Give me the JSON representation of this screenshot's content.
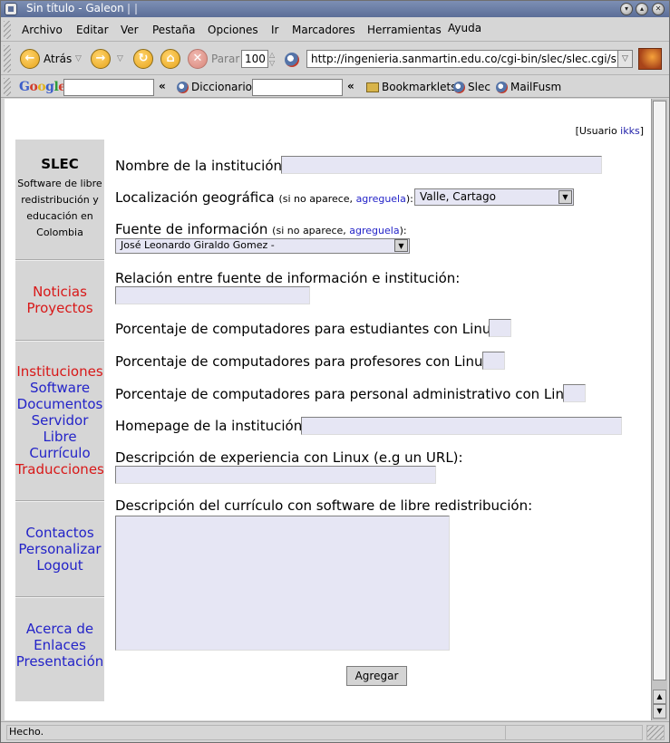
{
  "window": {
    "title": "Sin título - Galeon"
  },
  "menubar": [
    "Archivo",
    "Editar",
    "Ver",
    "Pestaña",
    "Opciones",
    "Ir",
    "Marcadores",
    "Herramientas",
    "Ayuda"
  ],
  "toolbar": {
    "back_label": "Atrás",
    "stop_label": "Parar",
    "zoom_value": "100",
    "url": "http://ingenieria.sanmartin.edu.co/cgi-bin/slec/slec.cgi/slec.a"
  },
  "bookmarks": {
    "google_label": "Google",
    "diccionario_label": "Diccionario",
    "bookmarklets_label": "Bookmarklets",
    "slec_label": "Slec",
    "mailfusm_label": "MailFusm"
  },
  "userbox": {
    "prefix": "[Usuario ",
    "user": "ikks",
    "suffix": "]"
  },
  "sidebar": {
    "title": "SLEC",
    "desc_lines": [
      "Software de libre",
      "redistribución y",
      "educación en",
      "Colombia"
    ],
    "group1": [
      {
        "label": "Noticias",
        "red": true
      },
      {
        "label": "Proyectos",
        "red": true
      }
    ],
    "group2": [
      {
        "label": "Instituciones",
        "red": true
      },
      {
        "label": "Software",
        "red": false
      },
      {
        "label": "Documentos",
        "red": false
      },
      {
        "label": "Servidor",
        "red": false
      },
      {
        "label": "Libre",
        "red": false
      },
      {
        "label": "Currículo",
        "red": false
      },
      {
        "label": "Traducciones",
        "red": true
      }
    ],
    "group3": [
      {
        "label": "Contactos",
        "red": false
      },
      {
        "label": "Personalizar",
        "red": false
      },
      {
        "label": "Logout",
        "red": false
      }
    ],
    "group4": [
      {
        "label": "Acerca de",
        "red": false
      },
      {
        "label": "Enlaces",
        "red": false
      },
      {
        "label": "Presentación",
        "red": false
      }
    ]
  },
  "form": {
    "nombre_label": "Nombre de la institución:",
    "localizacion_label": "Localización geográfica",
    "localizacion_hint_prefix": "(si no aparece, ",
    "localizacion_hint_link": "agreguela",
    "localizacion_hint_suffix": "):",
    "localizacion_value": "Valle, Cartago",
    "fuente_label": "Fuente de información",
    "fuente_hint_prefix": "(si no aparece, ",
    "fuente_hint_link": "agreguela",
    "fuente_hint_suffix": "):",
    "fuente_value": "José Leonardo Giraldo Gomez -",
    "relacion_label": "Relación entre fuente de información e institución:",
    "pct_estudiantes_label": "Porcentaje de computadores para estudiantes con Linux:",
    "pct_profesores_label": "Porcentaje de computadores para profesores con Linux:",
    "pct_admin_label": "Porcentaje de computadores para personal administrativo con Linux:",
    "homepage_label": "Homepage de la institución:",
    "experiencia_label": "Descripción de experiencia con Linux (e.g un URL):",
    "curriculo_label": "Descripción del currículo con software de libre redistribución:",
    "submit_label": "Agregar"
  },
  "status": {
    "text": "Hecho."
  }
}
